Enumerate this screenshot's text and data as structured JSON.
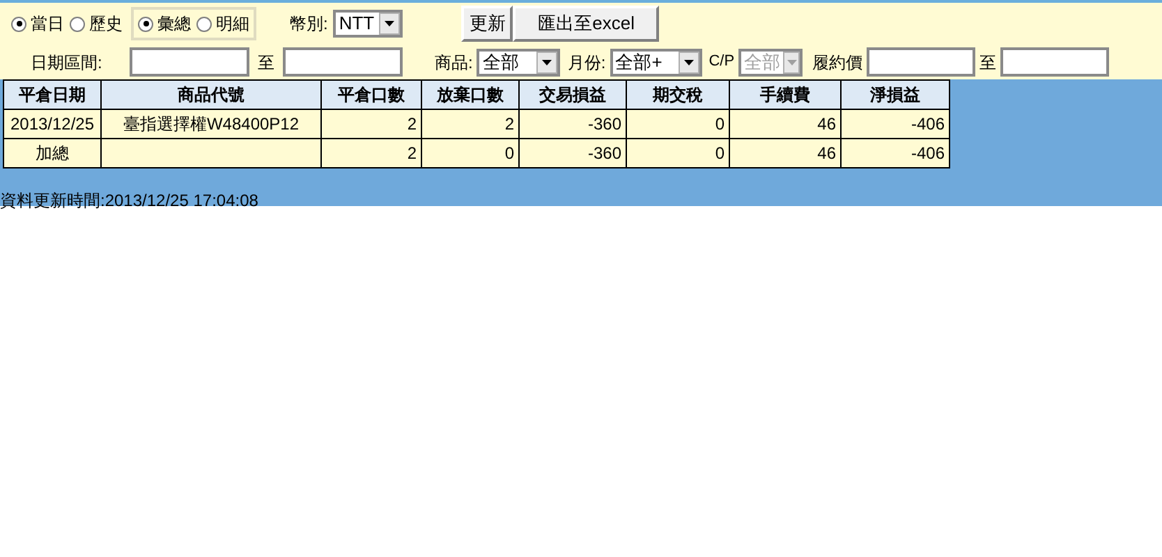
{
  "filters": {
    "period_options": [
      {
        "label": "當日",
        "selected": true
      },
      {
        "label": "歷史",
        "selected": false
      }
    ],
    "view_options": [
      {
        "label": "彙總",
        "selected": true
      },
      {
        "label": "明細",
        "selected": false
      }
    ],
    "currency": {
      "label": "幣別:",
      "value": "NTT"
    },
    "buttons": [
      "更新",
      "匯出至excel"
    ],
    "date_range": {
      "label": "日期區間:",
      "to": "至"
    },
    "product": {
      "label": "商品:",
      "value": "全部"
    },
    "month": {
      "label": "月份:",
      "value": "全部+"
    },
    "cp": {
      "label": "C/P",
      "value": "全部",
      "disabled": true
    },
    "strike": {
      "label": "履約價",
      "to": "至"
    }
  },
  "table": {
    "columns": [
      "平倉日期",
      "商品代號",
      "平倉口數",
      "放棄口數",
      "交易損益",
      "期交稅",
      "手續費",
      "淨損益"
    ],
    "rows": [
      [
        "2013/12/25",
        "臺指選擇權W48400P12",
        "2",
        "2",
        "-360",
        "0",
        "46",
        "-406"
      ],
      [
        "加總",
        "",
        "2",
        "0",
        "-360",
        "0",
        "46",
        "-406"
      ]
    ]
  },
  "update_time": "資料更新時間:2013/12/25 17:04:08"
}
